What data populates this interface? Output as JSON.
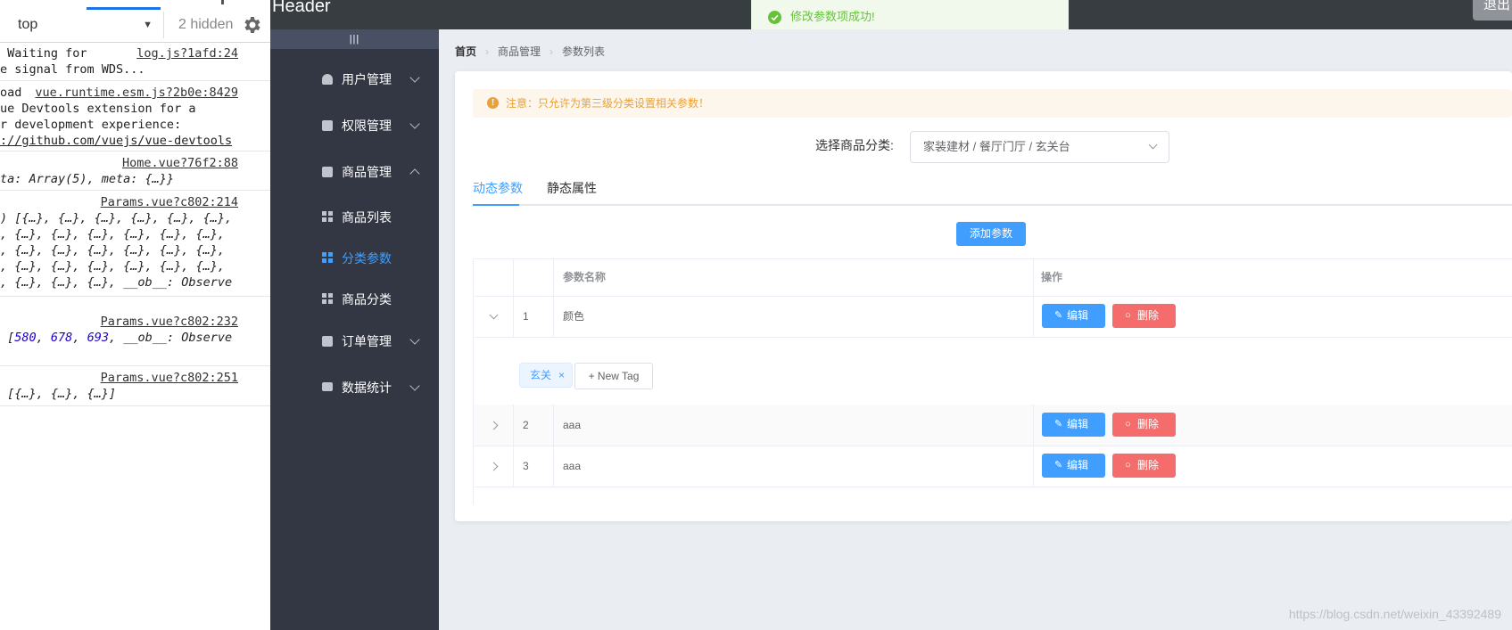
{
  "devtools": {
    "context": "top",
    "hidden_count": "2 hidden",
    "entries": [
      {
        "lines": [
          " Waiting for",
          "e signal from WDS..."
        ],
        "source": "log.js?1afd:24"
      },
      {
        "lines": [
          "oad",
          "ue Devtools extension for a",
          "r development experience:",
          "://github.com/vuejs/vue-devtools"
        ],
        "source": "vue.runtime.esm.js?2b0e:8429"
      },
      {
        "lines": [
          "",
          "ta: Array(5), meta: {…}}"
        ],
        "source": "Home.vue?76f2:88"
      },
      {
        "lines": [
          "",
          ") [{…}, {…}, {…}, {…}, {…}, {…},",
          ", {…}, {…}, {…}, {…}, {…}, {…},",
          ", {…}, {…}, {…}, {…}, {…}, {…},",
          ", {…}, {…}, {…}, {…}, {…}, {…},",
          ", {…}, {…}, {…}, __ob__: Observe"
        ],
        "source": "Params.vue?c802:214"
      },
      {
        "lines": [
          "",
          "",
          ", __ob__: Observe"
        ],
        "numbers": [
          "580",
          "678",
          "693"
        ],
        "source": "Params.vue?c802:232"
      },
      {
        "lines": [
          "",
          " [{…}, {…}, {…}]"
        ],
        "source": "Params.vue?c802:251"
      }
    ]
  },
  "header": {
    "title": "Header",
    "logout_label": "退出"
  },
  "toast": {
    "message": "修改参数项成功!"
  },
  "sidebar": {
    "toggle_label": "|||",
    "menus": [
      {
        "label": "用户管理"
      },
      {
        "label": "权限管理"
      },
      {
        "label": "商品管理"
      },
      {
        "label": "订单管理"
      },
      {
        "label": "数据统计"
      }
    ],
    "submenu": [
      {
        "label": "商品列表"
      },
      {
        "label": "分类参数"
      },
      {
        "label": "商品分类"
      }
    ]
  },
  "breadcrumb": [
    "首页",
    "商品管理",
    "参数列表"
  ],
  "alert": {
    "text": "注意：只允许为第三级分类设置相关参数！"
  },
  "category": {
    "label": "选择商品分类:",
    "value": "家装建材 / 餐厅门厅 / 玄关台"
  },
  "tabs": [
    "动态参数",
    "静态属性"
  ],
  "add_button": "添加参数",
  "table": {
    "columns": [
      "",
      "",
      "参数名称",
      "操作"
    ],
    "rows": [
      {
        "index": "1",
        "name": "颜色"
      },
      {
        "index": "2",
        "name": "aaa"
      },
      {
        "index": "3",
        "name": "aaa"
      }
    ],
    "edit_label": "编辑",
    "delete_label": "删除",
    "expanded_tags": [
      "玄关"
    ],
    "new_tag_label": "+ New Tag"
  },
  "watermark": "https://blog.csdn.net/weixin_43392489",
  "colors": {
    "primary": "#409eff",
    "danger": "#f56c6c",
    "sidebar": "#333744",
    "header": "#373d41",
    "warning": "#e6a23c",
    "success": "#67c23a"
  }
}
